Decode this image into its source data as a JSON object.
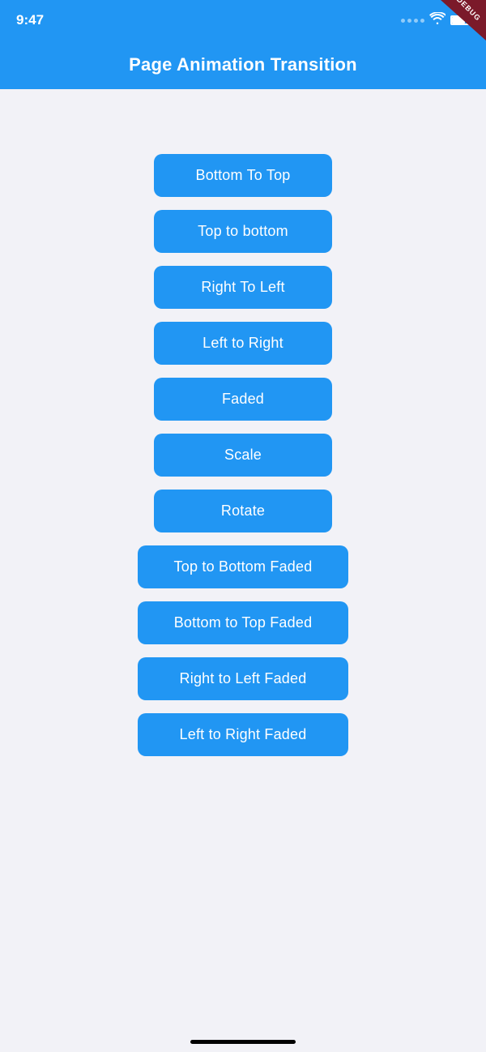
{
  "statusBar": {
    "time": "9:47"
  },
  "appBar": {
    "title": "Page Animation Transition"
  },
  "buttons": [
    {
      "id": "bottom-to-top",
      "label": "Bottom To Top",
      "wide": false
    },
    {
      "id": "top-to-bottom",
      "label": "Top to bottom",
      "wide": false
    },
    {
      "id": "right-to-left",
      "label": "Right To Left",
      "wide": false
    },
    {
      "id": "left-to-right",
      "label": "Left to Right",
      "wide": false
    },
    {
      "id": "faded",
      "label": "Faded",
      "wide": false
    },
    {
      "id": "scale",
      "label": "Scale",
      "wide": false
    },
    {
      "id": "rotate",
      "label": "Rotate",
      "wide": false
    },
    {
      "id": "top-to-bottom-faded",
      "label": "Top to Bottom Faded",
      "wide": true
    },
    {
      "id": "bottom-to-top-faded",
      "label": "Bottom to Top Faded",
      "wide": true
    },
    {
      "id": "right-to-left-faded",
      "label": "Right to Left Faded",
      "wide": true
    },
    {
      "id": "left-to-right-faded",
      "label": "Left to Right Faded",
      "wide": true
    }
  ]
}
